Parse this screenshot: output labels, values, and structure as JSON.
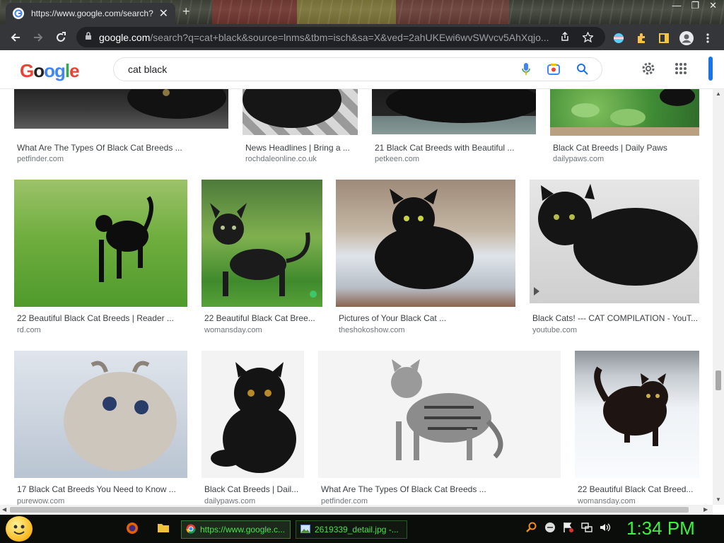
{
  "browser": {
    "tab_title": "https://www.google.com/search?",
    "tab_close": "✕",
    "new_tab": "+",
    "url_host": "google.com",
    "url_rest": "/search?q=cat+black&source=lnms&tbm=isch&sa=X&ved=2ahUKEwi6wvSWvcv5AhXqjo...",
    "window_controls": [
      "—",
      "❐",
      "✕"
    ]
  },
  "google": {
    "logo_letters": [
      "G",
      "o",
      "o",
      "g",
      "l",
      "e"
    ],
    "query": "cat black"
  },
  "colors": {
    "accent": "#1a73e8",
    "taskbar_text": "#4ee04e",
    "clock": "#3cf23c"
  },
  "results": {
    "rows": [
      [
        {
          "title": "What Are The Types Of Black Cat Breeds ...",
          "source": "petfinder.com",
          "img": "cat-lying-dark"
        },
        {
          "title": "News Headlines | Bring a ...",
          "source": "rochdaleonline.co.uk",
          "img": "cat-dark-checker"
        },
        {
          "title": "21 Black Cat Breeds with Beautiful ...",
          "source": "petkeen.com",
          "img": "cat-dark-mat"
        },
        {
          "title": "Black Cat Breeds | Daily Paws",
          "source": "dailypaws.com",
          "img": "cat-in-plants"
        }
      ],
      [
        {
          "title": "22 Beautiful Black Cat Breeds | Reader ...",
          "source": "rd.com",
          "img": "cat-on-grass"
        },
        {
          "title": "22 Beautiful Black Cat Bree...",
          "source": "womansday.com",
          "img": "curly-cat-grass"
        },
        {
          "title": "Pictures of Your Black Cat ...",
          "source": "theshokoshow.com",
          "img": "fluffy-cat-table"
        },
        {
          "title": "Black Cats! --- CAT COMPILATION - YouT...",
          "source": "youtube.com",
          "img": "black-cat-rug"
        }
      ],
      [
        {
          "title": "17 Black Cat Breeds You Need to Know ...",
          "source": "purewow.com",
          "img": "curl-ear-cat"
        },
        {
          "title": "Black Cat Breeds | Dail...",
          "source": "dailypaws.com",
          "img": "exotic-kitten"
        },
        {
          "title": "What Are The Types Of Black Cat Breeds ...",
          "source": "petfinder.com",
          "img": "tabby-cat-white"
        },
        {
          "title": "22 Beautiful Black Cat Breed...",
          "source": "womansday.com",
          "img": "cat-in-snow"
        }
      ]
    ]
  },
  "taskbar": {
    "buttons": [
      {
        "label": "https://www.google.c..."
      },
      {
        "label": "2619339_detail.jpg -..."
      }
    ],
    "clock": "1:34 PM"
  }
}
